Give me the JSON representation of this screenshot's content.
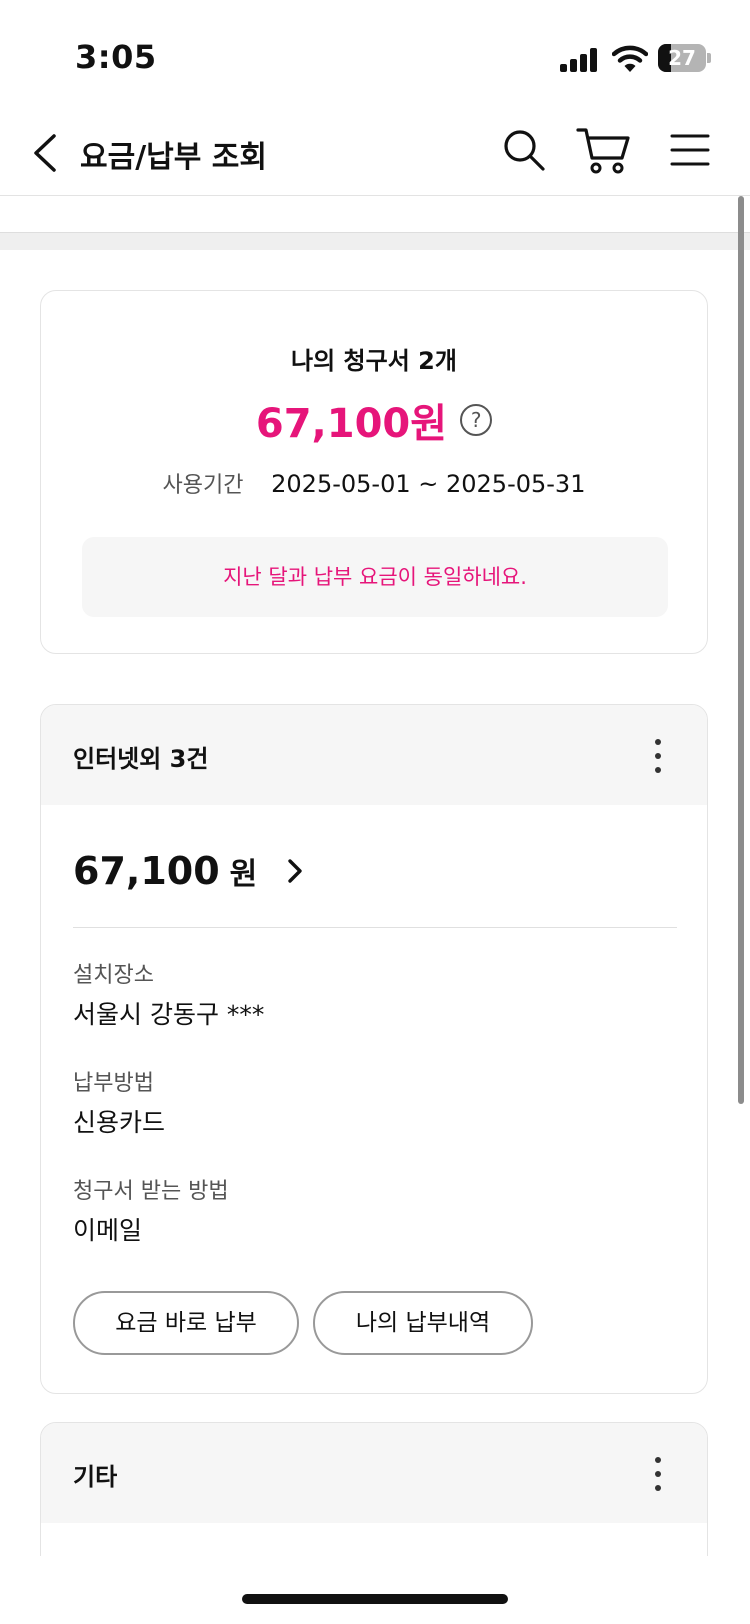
{
  "status_bar": {
    "time": "3:05",
    "battery": "27",
    "battery_level": 0.27
  },
  "header": {
    "title": "요금/납부 조회"
  },
  "summary": {
    "title": "나의 청구서 2개",
    "amount": "67,100원",
    "help_symbol": "?",
    "period_label": "사용기간",
    "period_value": "2025-05-01 ~ 2025-05-31",
    "notice": "지난 달과 납부 요금이 동일하네요."
  },
  "bill": {
    "title": "인터넷외 3건",
    "amount": "67,100",
    "unit": "원",
    "install_location_label": "설치장소",
    "install_location_value": "서울시 강동구 ***",
    "payment_method_label": "납부방법",
    "payment_method_value": "신용카드",
    "bill_delivery_label": "청구서 받는 방법",
    "bill_delivery_value": "이메일",
    "pay_now_button": "요금 바로 납부",
    "history_button": "나의 납부내역"
  },
  "other": {
    "title": "기타"
  },
  "colors": {
    "accent": "#e6157a",
    "card_head_bg": "#f6f6f6",
    "border": "#e4e4e4"
  }
}
